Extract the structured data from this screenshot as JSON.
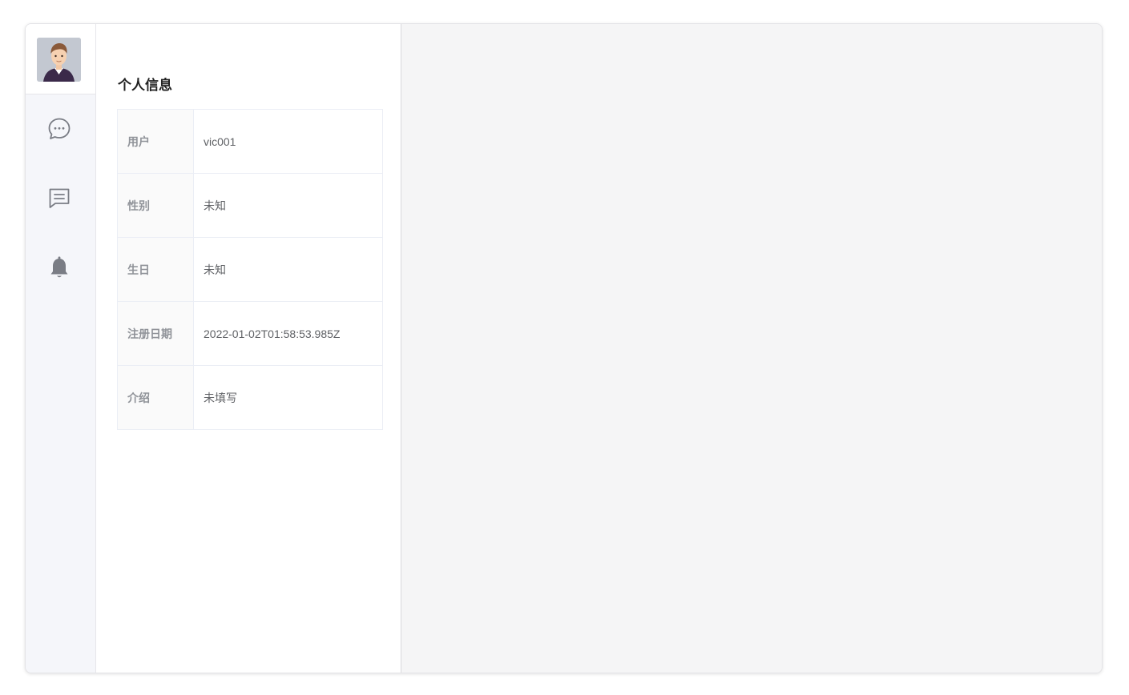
{
  "panel": {
    "title": "个人信息"
  },
  "profile": {
    "rows": [
      {
        "label": "用户",
        "value": "vic001"
      },
      {
        "label": "性别",
        "value": "未知"
      },
      {
        "label": "生日",
        "value": "未知"
      },
      {
        "label": "注册日期",
        "value": "2022-01-02T01:58:53.985Z"
      },
      {
        "label": "介绍",
        "value": "未填写"
      }
    ]
  },
  "sidebar": {
    "icons": [
      "chat-bubble-icon",
      "message-icon",
      "bell-icon"
    ]
  },
  "colors": {
    "icon": "#7a7d85",
    "label": "#909399",
    "value": "#606266",
    "title": "#222222"
  }
}
